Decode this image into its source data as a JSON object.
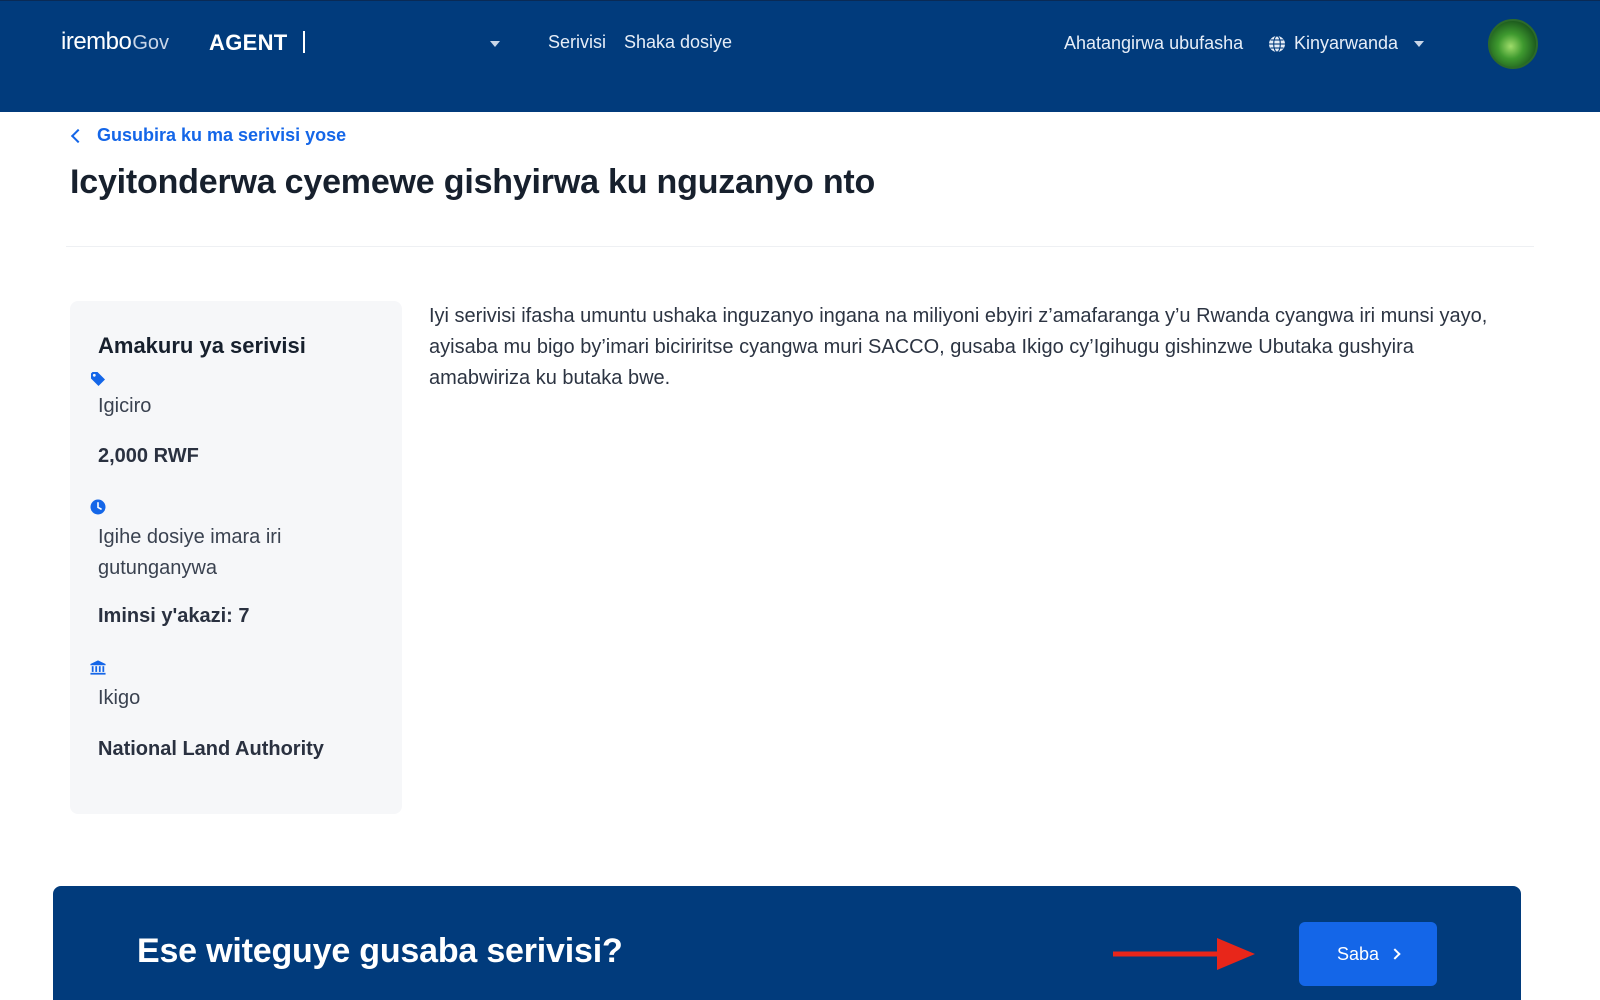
{
  "header": {
    "logo_main": "irembo",
    "logo_gov": "Gov",
    "agent_label": "AGENT",
    "nav": {
      "services": "Serivisi",
      "search_application": "Shaka dosiye"
    },
    "help": "Ahatangirwa ubufasha",
    "language": "Kinyarwanda"
  },
  "page": {
    "back_link": "Gusubira ku ma serivisi yose",
    "title": "Icyitonderwa cyemewe gishyirwa ku nguzanyo nto"
  },
  "service_info": {
    "heading": "Amakuru ya serivisi",
    "price_label": "Igiciro",
    "price_value": "2,000 RWF",
    "processing_label": "Igihe dosiye imara iri gutunganywa",
    "processing_value": "Iminsi y'akazi: 7",
    "institution_label": "Ikigo",
    "institution_value": "National Land Authority"
  },
  "description": "Iyi serivisi ifasha umuntu ushaka inguzanyo ingana na miliyoni ebyiri z’amafaranga y’u Rwanda cyangwa iri munsi yayo, ayisaba mu bigo by’imari biciriritse cyangwa muri SACCO, gusaba Ikigo cy’Igihugu gishinzwe Ubutaka gushyira amabwiriza ku butaka bwe.",
  "banner": {
    "prompt": "Ese witeguye gusaba serivisi?",
    "apply_label": "Saba"
  },
  "colors": {
    "header_bg": "#013b7c",
    "accent": "#1466e8",
    "annotation_arrow": "#e8261a"
  }
}
